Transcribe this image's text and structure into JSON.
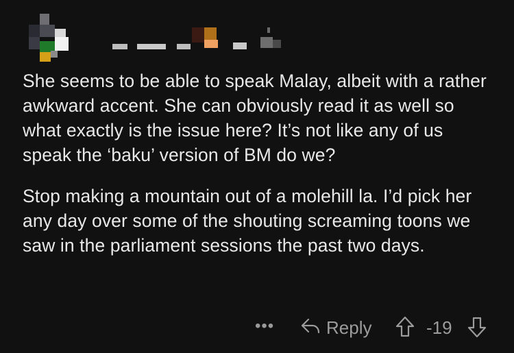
{
  "comment": {
    "paragraphs": [
      "She seems to be able to speak Malay, albeit with a rather awkward accent. She can obviously read it as well so what exactly is the issue here? It’s not like any of us speak the ‘baku’ version of BM do we?",
      "Stop making a mountain out of a molehill la. I’d pick her any day over some of the shouting screaming toons we saw in the parliament sessions the past two days."
    ]
  },
  "actions": {
    "more_label": "•••",
    "reply_label": "Reply",
    "score": "-19"
  },
  "icons": {
    "reply": "reply-arrow-icon",
    "upvote": "upvote-arrow-icon",
    "downvote": "downvote-arrow-icon",
    "more": "more-dots-icon"
  },
  "colors": {
    "background": "#111112",
    "text": "#e8e8e8",
    "muted": "#9c9c9c"
  }
}
